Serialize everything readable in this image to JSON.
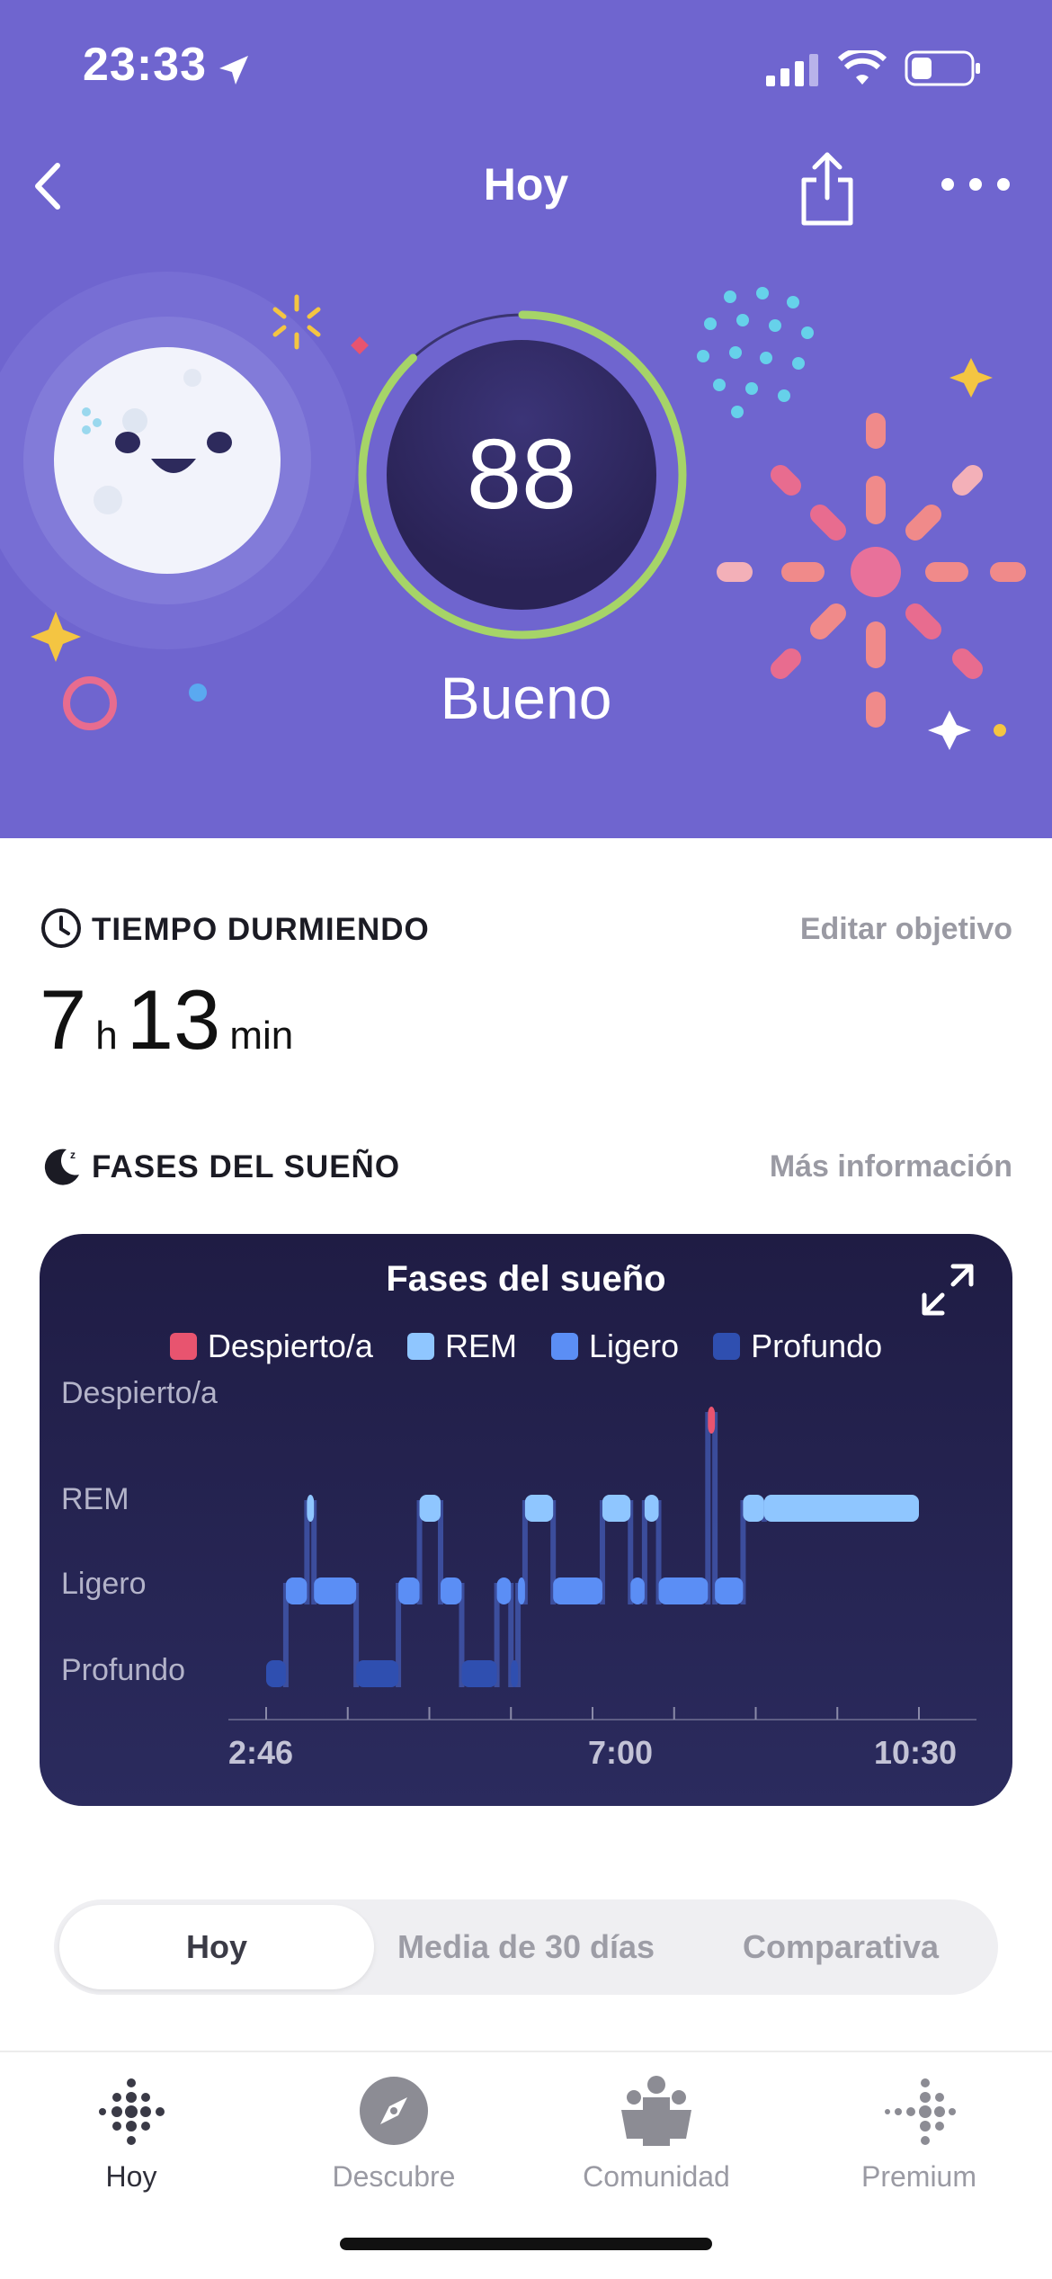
{
  "status_bar": {
    "time": "23:33"
  },
  "nav": {
    "title": "Hoy",
    "back": "back-icon",
    "share": "share-icon",
    "more": "more-icon"
  },
  "hero": {
    "score": "88",
    "score_fraction": 0.88,
    "quality": "Bueno",
    "colors": {
      "bg": "#6f65cf",
      "ring": "#a6d468"
    }
  },
  "sleep_time": {
    "heading": "TIEMPO DURMIENDO",
    "edit_link": "Editar objetivo",
    "hours": "7",
    "hours_unit": "h",
    "minutes": "13",
    "minutes_unit": "min"
  },
  "stages": {
    "heading": "FASES DEL SUEÑO",
    "info_link": "Más información",
    "card_title": "Fases del sueño"
  },
  "chart_data": {
    "type": "line",
    "title": "Fases del sueño",
    "legend": [
      {
        "name": "Despierto/a",
        "color": "#e8546f"
      },
      {
        "name": "REM",
        "color": "#8fc6ff"
      },
      {
        "name": "Ligero",
        "color": "#5b8ef5"
      },
      {
        "name": "Profundo",
        "color": "#2f4fb0"
      }
    ],
    "y_categories": [
      "Despierto/a",
      "REM",
      "Ligero",
      "Profundo"
    ],
    "x_tick_labels": [
      "2:46",
      "7:00",
      "10:30"
    ],
    "x_range": [
      "2:46",
      "10:30"
    ],
    "segments": [
      {
        "start": "2:46",
        "end": "3:00",
        "stage": "Profundo"
      },
      {
        "start": "3:00",
        "end": "3:15",
        "stage": "Ligero"
      },
      {
        "start": "3:15",
        "end": "3:20",
        "stage": "REM"
      },
      {
        "start": "3:20",
        "end": "3:50",
        "stage": "Ligero"
      },
      {
        "start": "3:50",
        "end": "4:20",
        "stage": "Profundo"
      },
      {
        "start": "4:20",
        "end": "4:35",
        "stage": "Ligero"
      },
      {
        "start": "4:35",
        "end": "4:50",
        "stage": "REM"
      },
      {
        "start": "4:50",
        "end": "5:05",
        "stage": "Ligero"
      },
      {
        "start": "5:05",
        "end": "5:30",
        "stage": "Profundo"
      },
      {
        "start": "5:30",
        "end": "5:40",
        "stage": "Ligero"
      },
      {
        "start": "5:40",
        "end": "5:45",
        "stage": "Profundo"
      },
      {
        "start": "5:45",
        "end": "5:50",
        "stage": "Ligero"
      },
      {
        "start": "5:50",
        "end": "6:10",
        "stage": "REM"
      },
      {
        "start": "6:10",
        "end": "6:45",
        "stage": "Ligero"
      },
      {
        "start": "6:45",
        "end": "7:05",
        "stage": "REM"
      },
      {
        "start": "7:05",
        "end": "7:15",
        "stage": "Ligero"
      },
      {
        "start": "7:15",
        "end": "7:25",
        "stage": "REM"
      },
      {
        "start": "7:25",
        "end": "8:00",
        "stage": "Ligero"
      },
      {
        "start": "8:00",
        "end": "8:05",
        "stage": "Despierto/a"
      },
      {
        "start": "8:05",
        "end": "8:25",
        "stage": "Ligero"
      },
      {
        "start": "8:25",
        "end": "8:40",
        "stage": "REM"
      },
      {
        "start": "8:40",
        "end": "10:30",
        "stage": "REM"
      }
    ]
  },
  "segment_control": {
    "options": [
      "Hoy",
      "Media de 30 días",
      "Comparativa"
    ],
    "active": "Hoy"
  },
  "tabbar": [
    {
      "label": "Hoy",
      "icon": "fitbit-dots-icon"
    },
    {
      "label": "Descubre",
      "icon": "compass-icon"
    },
    {
      "label": "Comunidad",
      "icon": "community-icon"
    },
    {
      "label": "Premium",
      "icon": "premium-dots-icon"
    }
  ]
}
